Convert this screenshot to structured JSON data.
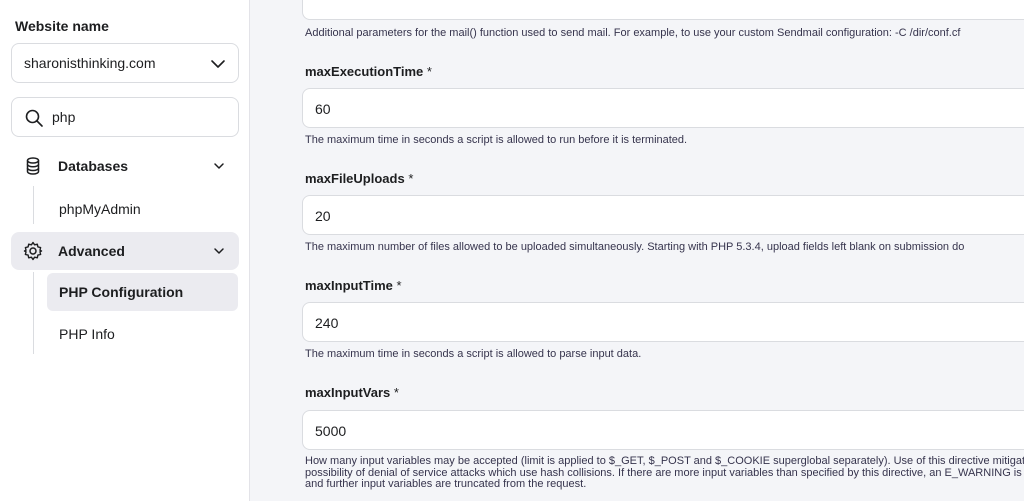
{
  "sidebar": {
    "website_label": "Website name",
    "website_value": "sharonisthinking.com",
    "search_value": "php",
    "nav": [
      {
        "label": "Databases",
        "icon": "database-icon"
      },
      {
        "label": "Advanced",
        "icon": "gear-icon"
      }
    ],
    "db_sub": [
      {
        "label": "phpMyAdmin"
      }
    ],
    "adv_sub": [
      {
        "label": "PHP Configuration",
        "active": true
      },
      {
        "label": "PHP Info"
      }
    ]
  },
  "main": {
    "top_desc": "Additional parameters for the mail() function used to send mail. For example, to use your custom Sendmail configuration: -C /dir/conf.cf",
    "fields": [
      {
        "label": "maxExecutionTime",
        "required": "*",
        "value": "60",
        "desc": "The maximum time in seconds a script is allowed to run before it is terminated."
      },
      {
        "label": "maxFileUploads",
        "required": "*",
        "value": "20",
        "desc": "The maximum number of files allowed to be uploaded simultaneously. Starting with PHP 5.3.4, upload fields left blank on submission do"
      },
      {
        "label": "maxInputTime",
        "required": "*",
        "value": "240",
        "desc": "The maximum time in seconds a script is allowed to parse input data."
      },
      {
        "label": "maxInputVars",
        "required": "*",
        "value": "5000",
        "desc": "How many input variables may be accepted (limit is applied to $_GET, $_POST and $_COOKIE superglobal separately). Use of this directive mitigates the possibility of denial of service attacks which use hash collisions. If there are more input variables than specified by this directive, an E_WARNING is issued, and further input variables are truncated from the request."
      }
    ]
  },
  "colors": {
    "active_bg": "#ebebf0",
    "page_bg": "#f4f5f8",
    "text": "#1d1e20"
  }
}
